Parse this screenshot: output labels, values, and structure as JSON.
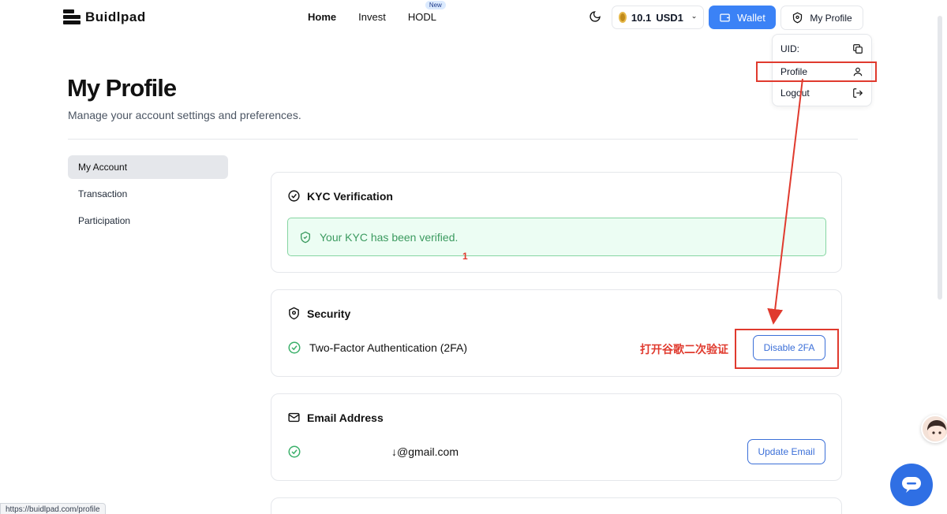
{
  "brand": {
    "name": "Buidlpad"
  },
  "nav": {
    "items": [
      {
        "label": "Home",
        "active": true
      },
      {
        "label": "Invest",
        "active": false
      },
      {
        "label": "HODL",
        "active": false
      }
    ],
    "new_badge": "New"
  },
  "header": {
    "balance_amount": "10.1",
    "balance_currency": "USD1",
    "wallet_label": "Wallet",
    "profile_label": "My Profile",
    "accent_color": "#3b82f6"
  },
  "dropdown": {
    "items": [
      {
        "label": "UID:",
        "icon": "copy-icon"
      },
      {
        "label": "Profile",
        "icon": "user-icon"
      },
      {
        "label": "Logout",
        "icon": "logout-icon"
      }
    ]
  },
  "page": {
    "title": "My Profile",
    "subtitle": "Manage your account settings and preferences."
  },
  "sidebar": {
    "items": [
      {
        "label": "My Account",
        "active": true
      },
      {
        "label": "Transaction",
        "active": false
      },
      {
        "label": "Participation",
        "active": false
      }
    ]
  },
  "kyc": {
    "title": "KYC Verification",
    "status_text": "Your KYC has been verified."
  },
  "security": {
    "title": "Security",
    "two_fa_label": "Two-Factor Authentication (2FA)",
    "disable_button": "Disable 2FA"
  },
  "email": {
    "title": "Email Address",
    "value": "↓@gmail.com",
    "update_button": "Update Email"
  },
  "annotations": {
    "marker": "1",
    "note": "打开谷歌二次验证",
    "color": "#e03a2e"
  },
  "status_bar": {
    "url": "https://buidlpad.com/profile"
  }
}
